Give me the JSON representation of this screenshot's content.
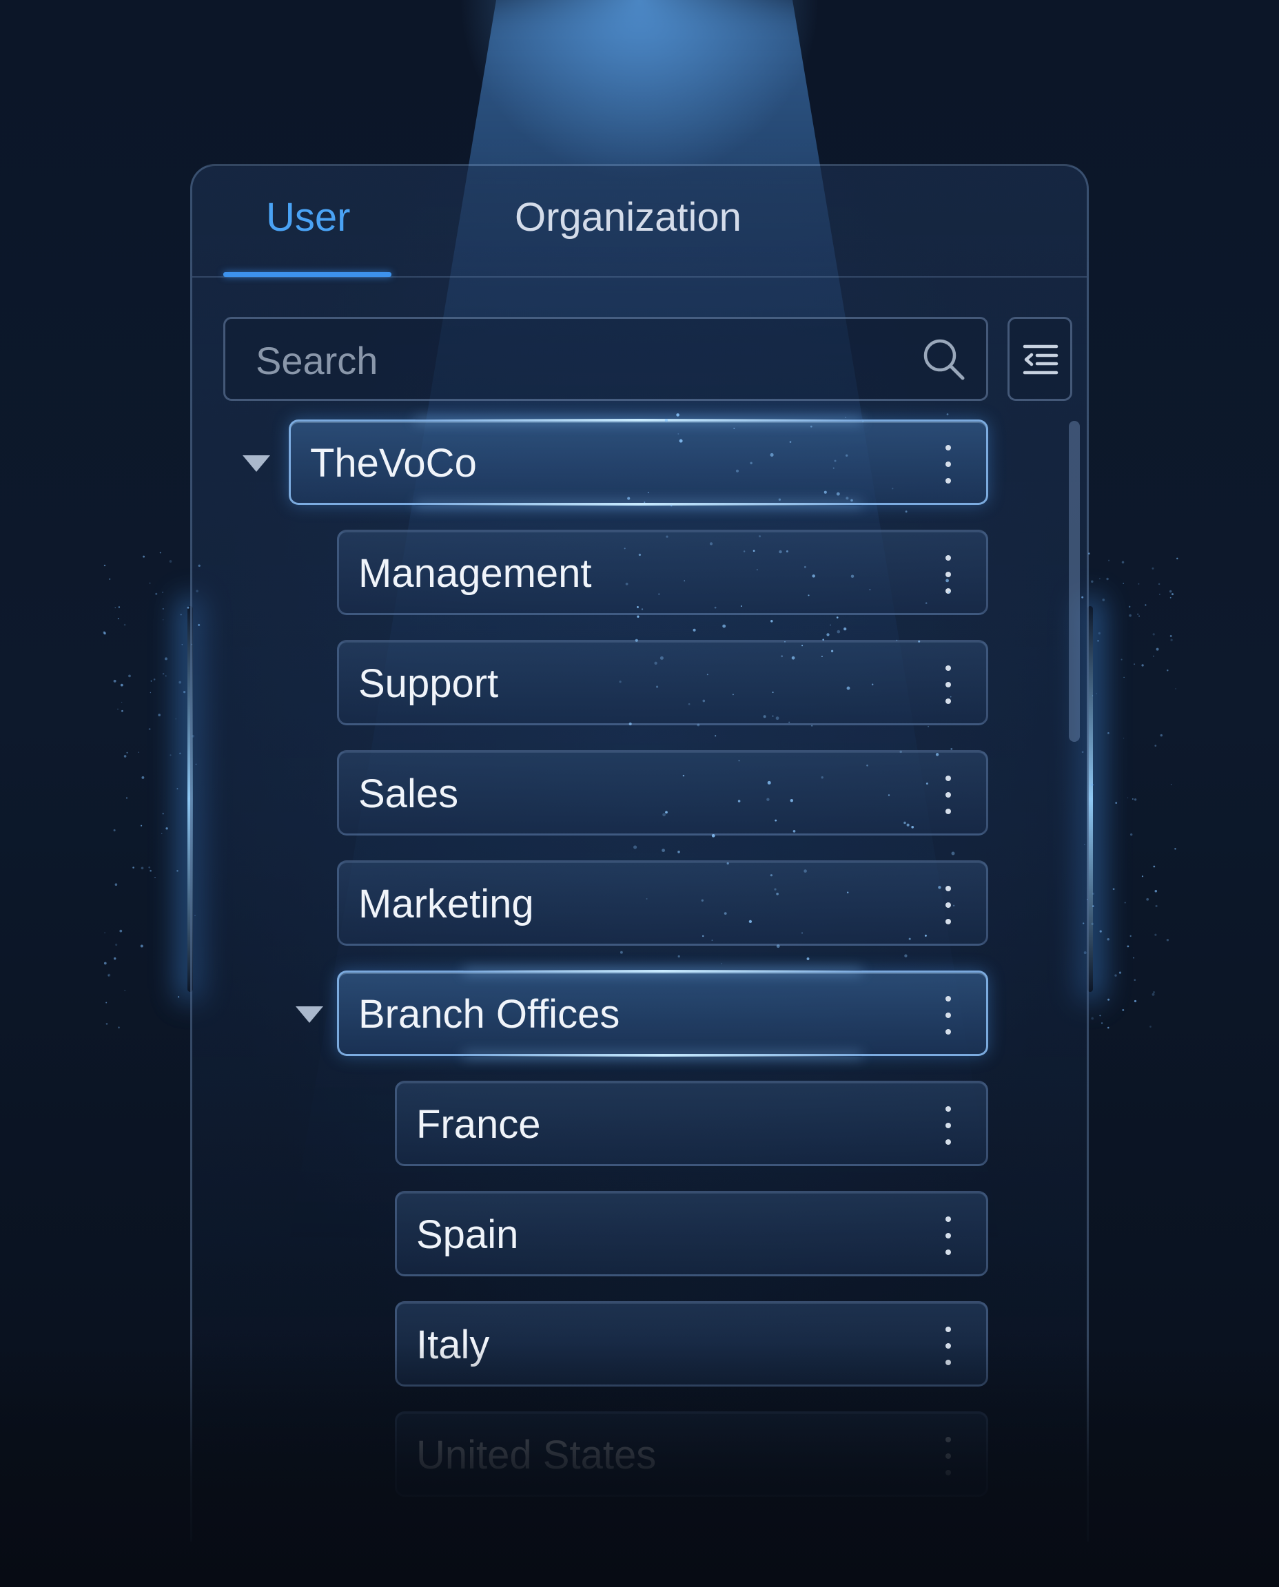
{
  "tabs": [
    {
      "label": "User",
      "active": true
    },
    {
      "label": "Organization",
      "active": false
    }
  ],
  "search": {
    "placeholder": "Search",
    "value": ""
  },
  "tree": {
    "root": {
      "label": "TheVoCo",
      "expanded": true
    },
    "children": [
      {
        "label": "Management"
      },
      {
        "label": "Support"
      },
      {
        "label": "Sales"
      },
      {
        "label": "Marketing"
      }
    ],
    "branch": {
      "label": "Branch Offices",
      "expanded": true
    },
    "branch_children": [
      {
        "label": "France"
      },
      {
        "label": "Spain"
      },
      {
        "label": "Italy"
      },
      {
        "label": "United States"
      }
    ]
  },
  "icons": {
    "search": "search-icon",
    "filter": "collapse-list-icon",
    "expand": "caret-down-icon",
    "more": "more-vertical-icon"
  },
  "colors": {
    "accent": "#3d92ec",
    "active_tab": "#4aa3f5",
    "background": "#0b1424",
    "text": "#f0f4fa"
  }
}
